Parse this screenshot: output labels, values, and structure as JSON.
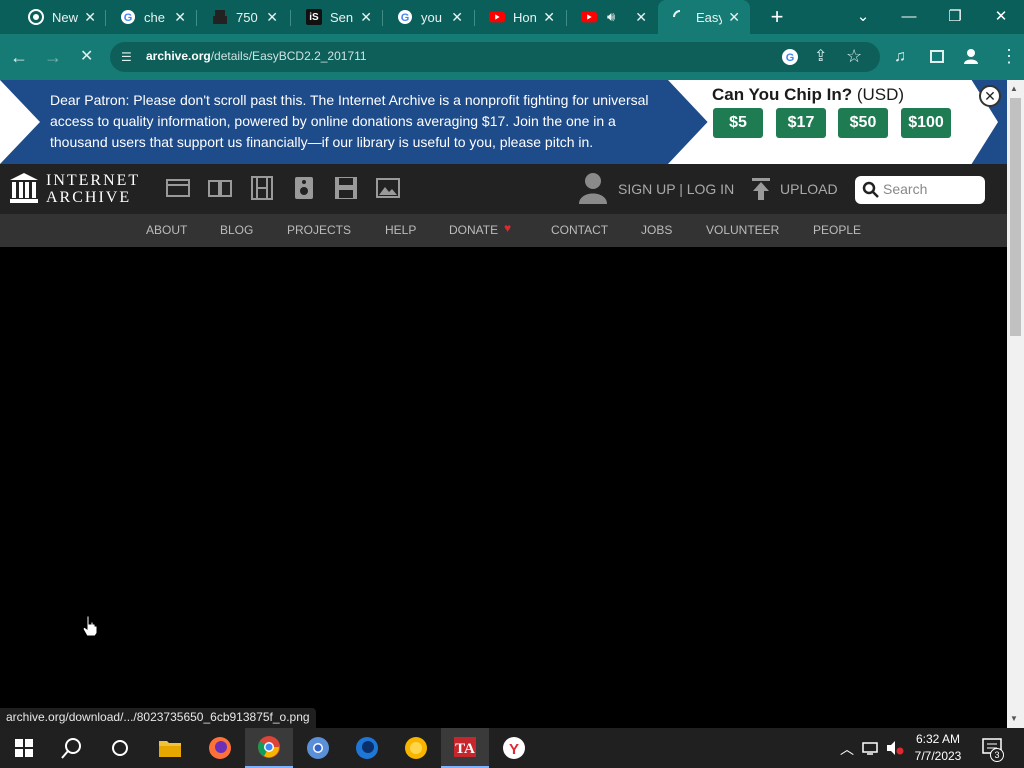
{
  "browser": {
    "tabs": [
      {
        "title": "New",
        "icon": "chrome-icon",
        "color": "#ffffff"
      },
      {
        "title": "che",
        "icon": "google-icon",
        "color": "#ffffff"
      },
      {
        "title": "750",
        "icon": "printer-icon",
        "color": "#ffffff"
      },
      {
        "title": "Sen",
        "icon": "is-logo-icon",
        "color": "#ffffff"
      },
      {
        "title": "you",
        "icon": "google-icon",
        "color": "#ffffff"
      },
      {
        "title": "Hon",
        "icon": "youtube-icon",
        "color": "#ff0000"
      },
      {
        "title": "",
        "icon": "youtube-icon",
        "color": "#ff0000"
      },
      {
        "title": "Easy",
        "icon": "loading-icon",
        "color": "#ffffff"
      }
    ],
    "url_host": "archive.org",
    "url_path": "/details/EasyBCD2.2_201711",
    "status_url": "archive.org/download/.../8023735650_6cb913875f_o.png"
  },
  "banner": {
    "text": "Dear Patron: Please don't scroll past this. The Internet Archive is a nonprofit fighting for universal access to quality information, powered by online donations averaging $17. Join the one in a thousand users that support us financially—if our library is useful to you, please pitch in.",
    "chip_title": "Can You Chip In?",
    "chip_currency": "(USD)",
    "amounts": [
      "$5",
      "$17",
      "$50",
      "$100"
    ],
    "accent": "#1f7b52",
    "background": "#1e4b8a"
  },
  "ia": {
    "logo_line1": "INTERNET",
    "logo_line2": "ARCHIVE",
    "signup_label": "SIGN UP | LOG IN",
    "upload_label": "UPLOAD",
    "search_placeholder": "Search",
    "nav": [
      "ABOUT",
      "BLOG",
      "PROJECTS",
      "HELP",
      "DONATE",
      "CONTACT",
      "JOBS",
      "VOLUNTEER",
      "PEOPLE"
    ]
  },
  "taskbar": {
    "time": "6:32 AM",
    "date": "7/7/2023",
    "notification_count": "3"
  }
}
